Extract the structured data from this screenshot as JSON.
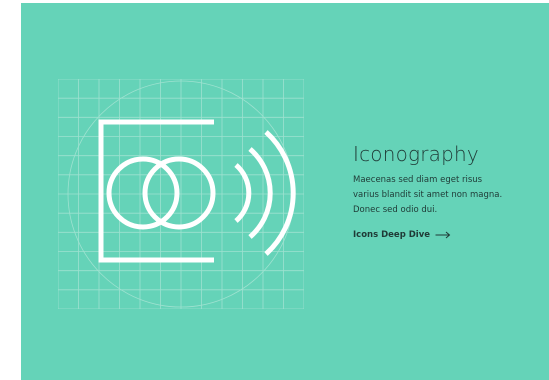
{
  "colors": {
    "background": "#65d3b8",
    "grid_line": "#9ee2d0",
    "icon_stroke": "#ffffff",
    "text": "#1f3a36"
  },
  "hero": {
    "title": "Iconography",
    "body_lines": [
      "Maecenas sed diam eget risus",
      "varius blandit sit amet non magna.",
      "Donec sed odio dui."
    ],
    "cta_label": "Icons Deep Dive"
  },
  "icons": {
    "cta_arrow": "arrow-right-icon",
    "illustration": "iconography-grid-icon"
  }
}
